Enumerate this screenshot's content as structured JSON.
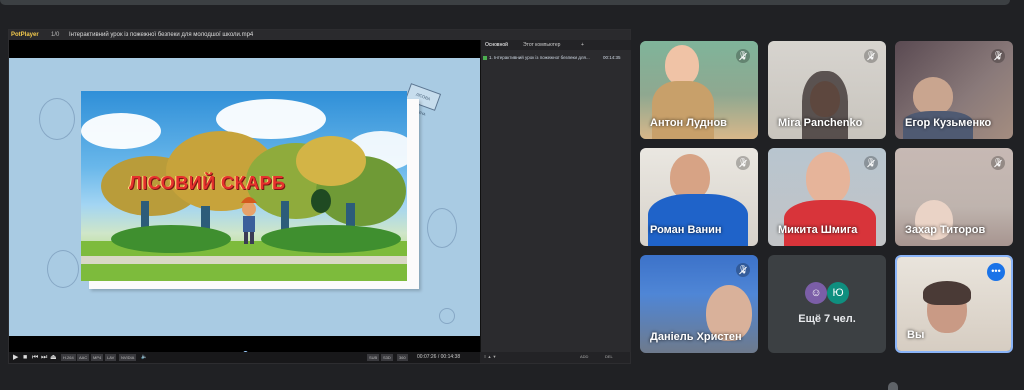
{
  "player": {
    "app_name": "PotPlayer",
    "version": "1/0",
    "file_title": "Інтерактивний урок із пожежної безпеки для молодшої школи.mp4",
    "film_title": "ЛІСОВИЙ СКАРБ",
    "sign_text": "ЛІСОВА ПОЛЯНА",
    "time_current": "00:07:26",
    "time_total": "00:14:38",
    "progress": 0.5,
    "control_chips": [
      "H.264",
      "AAC",
      "MP4",
      "LAV",
      "NVIDIA"
    ],
    "right_chips": [
      "SUB",
      "S3D",
      "360"
    ],
    "playlist": {
      "tabs": [
        "Основной",
        "Этот компьютер",
        "+"
      ],
      "items": [
        {
          "title": "1. Інтерактивний урок із пожежної безпеки для...",
          "duration": "00:14:35"
        }
      ],
      "footer_buttons": [
        "ADD",
        "DEL"
      ]
    }
  },
  "participants": [
    {
      "name": "Антон Луднов",
      "muted": true
    },
    {
      "name": "Mira Panchenko",
      "muted": true
    },
    {
      "name": "Егор Кузьменко",
      "muted": true
    },
    {
      "name": "Роман Ванин",
      "muted": true
    },
    {
      "name": "Микита Шмига",
      "muted": true
    },
    {
      "name": "Захар Титоров",
      "muted": true
    },
    {
      "name": "Даніель Христен",
      "muted": true
    }
  ],
  "more_tile": {
    "label": "Ещё 7 чел.",
    "avatar_letter": "Ю"
  },
  "self_tile": {
    "name": "Вы",
    "menu": "•••"
  },
  "colors": {
    "meet_bg": "#202124",
    "tile_bg": "#3c4043",
    "accent": "#1a73e8",
    "highlight": "#8ab4f8"
  }
}
